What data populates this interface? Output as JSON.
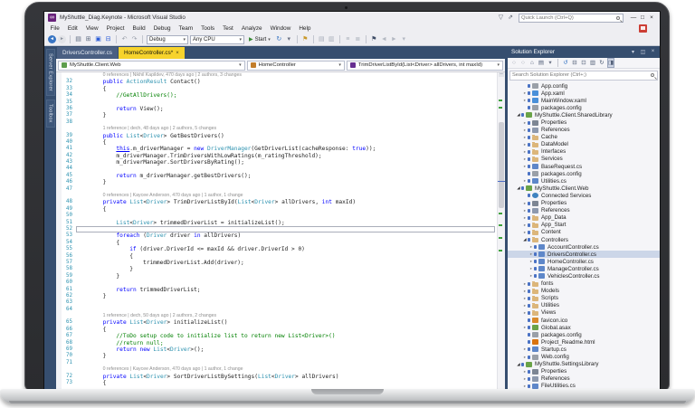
{
  "window": {
    "title": "MyShuttle_Diag.Keynote - Microsoft Visual Studio",
    "quick_launch_placeholder": "Quick Launch (Ctrl+Q)",
    "titlebar_icons": [
      {
        "name": "feedback-icon",
        "glyph": "▽"
      },
      {
        "name": "send-feedback-icon",
        "glyph": "⇗"
      }
    ],
    "buttons": [
      {
        "name": "minimize-button",
        "glyph": "—"
      },
      {
        "name": "maximize-button",
        "glyph": "□"
      },
      {
        "name": "close-button",
        "glyph": "×"
      }
    ]
  },
  "menus": [
    "File",
    "Edit",
    "View",
    "Project",
    "Build",
    "Debug",
    "Team",
    "Tools",
    "Test",
    "Analyze",
    "Window",
    "Help"
  ],
  "toolbar": {
    "config_dropdown": "Debug",
    "platform_dropdown": "Any CPU",
    "start_label": "Start",
    "icons_left": [
      {
        "name": "nav-back-icon",
        "glyph": "◄",
        "fg": "#ffffff",
        "bg": "#3a76c4"
      },
      {
        "name": "nav-forward-icon",
        "glyph": "►",
        "fg": "#8d94a0",
        "bg": "#e3e4e8"
      },
      {
        "name": "sep"
      },
      {
        "name": "new-project-icon",
        "glyph": "▤",
        "fg": "#5d6a80"
      },
      {
        "name": "add-item-icon",
        "glyph": "⊞",
        "fg": "#5d6a80"
      },
      {
        "name": "save-icon",
        "glyph": "▣",
        "fg": "#2a5bd7"
      },
      {
        "name": "save-all-icon",
        "glyph": "⊟",
        "fg": "#2a5bd7"
      },
      {
        "name": "sep"
      },
      {
        "name": "undo-icon",
        "glyph": "↶",
        "fg": "#9aa0ab"
      },
      {
        "name": "redo-icon",
        "glyph": "↷",
        "fg": "#9aa0ab"
      },
      {
        "name": "sep"
      }
    ],
    "icons_right": [
      {
        "name": "refresh-icon",
        "glyph": "↻",
        "fg": "#3a76c4"
      },
      {
        "name": "refresh-caret-icon",
        "glyph": "▾",
        "fg": "#6a7184"
      },
      {
        "name": "sep"
      },
      {
        "name": "intellitrace-icon",
        "glyph": "⚑",
        "fg": "#c9992a"
      },
      {
        "name": "sep"
      },
      {
        "name": "find-in-files-icon",
        "glyph": "▤",
        "fg": "#a7adb8"
      },
      {
        "name": "document-outline-icon",
        "glyph": "▥",
        "fg": "#a7adb8"
      },
      {
        "name": "sep"
      },
      {
        "name": "comment-icon",
        "glyph": "≡",
        "fg": "#a7adb8"
      },
      {
        "name": "uncomment-icon",
        "glyph": "≣",
        "fg": "#a7adb8"
      },
      {
        "name": "sep"
      },
      {
        "name": "bookmark-icon",
        "glyph": "⚑",
        "fg": "#3e4c66"
      },
      {
        "name": "bookmark-prev-icon",
        "glyph": "◄",
        "fg": "#b3b8c2"
      },
      {
        "name": "bookmark-next-icon",
        "glyph": "►",
        "fg": "#b3b8c2"
      },
      {
        "name": "bookmark-menu-icon",
        "glyph": "▾",
        "fg": "#b3b8c2"
      }
    ]
  },
  "left_tabs": [
    "Server Explorer",
    "Toolbox"
  ],
  "editor_tabs": [
    {
      "label": "DriversController.cs",
      "active": false,
      "dirty": ""
    },
    {
      "label": "HomeController.cs",
      "active": true,
      "dirty": "*"
    }
  ],
  "navbar": {
    "project": "MyShuttle.Client.Web",
    "type": "HomeController",
    "member": "TrimDriverListById(List<Driver> allDrivers, int maxId)"
  },
  "code": {
    "lines": [
      {
        "lens": "0 references | Nikhil Kapildev, 470 days ago | 2 authors, 3 changes",
        "sp": 8
      },
      {
        "n": 32,
        "sp": 8,
        "tok": [
          [
            "k",
            "public "
          ],
          [
            "t",
            "ActionResult"
          ],
          [
            "p",
            " Contact()"
          ]
        ]
      },
      {
        "n": 33,
        "sp": 8,
        "tok": [
          [
            "p",
            "{"
          ]
        ]
      },
      {
        "n": 34,
        "sp": 12,
        "tok": [
          [
            "c",
            "//GetAllDrivers();"
          ]
        ]
      },
      {
        "n": 35,
        "sp": 0,
        "tok": []
      },
      {
        "n": 36,
        "sp": 12,
        "tok": [
          [
            "k",
            "return"
          ],
          [
            "p",
            " View();"
          ]
        ]
      },
      {
        "n": 37,
        "sp": 8,
        "tok": [
          [
            "p",
            "}"
          ]
        ]
      },
      {
        "n": 38,
        "sp": 0,
        "tok": []
      },
      {
        "lens": "1 reference | dech, 48 days ago | 2 authors, 5 changes",
        "sp": 8
      },
      {
        "n": 39,
        "sp": 8,
        "tok": [
          [
            "k",
            "public "
          ],
          [
            "t",
            "List"
          ],
          [
            "p",
            "<"
          ],
          [
            "t",
            "Driver"
          ],
          [
            "p",
            "> GetBestDrivers()"
          ]
        ]
      },
      {
        "n": 40,
        "sp": 8,
        "tok": [
          [
            "p",
            "{"
          ]
        ]
      },
      {
        "n": 41,
        "sp": 12,
        "tok": [
          [
            "ku",
            "this"
          ],
          [
            "p",
            ".m_driverManager = "
          ],
          [
            "k",
            "new "
          ],
          [
            "t",
            "DriverManager"
          ],
          [
            "p",
            "(GetDriverList(cacheResponse: "
          ],
          [
            "k",
            "true"
          ],
          [
            "p",
            "));"
          ]
        ]
      },
      {
        "n": 42,
        "sp": 12,
        "tok": [
          [
            "p",
            "m_driverManager.TrimDriversWithLowRatings(m_ratingThreshold);"
          ]
        ]
      },
      {
        "n": 43,
        "sp": 12,
        "tok": [
          [
            "p",
            "m_driverManager.SortDriversByRating();"
          ]
        ]
      },
      {
        "n": 44,
        "sp": 0,
        "tok": []
      },
      {
        "n": 45,
        "sp": 12,
        "tok": [
          [
            "k",
            "return"
          ],
          [
            "p",
            " m_driverManager.getBestDrivers();"
          ]
        ]
      },
      {
        "n": 46,
        "sp": 8,
        "tok": [
          [
            "p",
            "}"
          ]
        ]
      },
      {
        "n": 47,
        "sp": 0,
        "tok": []
      },
      {
        "lens": "0 references | Kaycee Anderson, 470 days ago | 1 author, 1 change",
        "sp": 8
      },
      {
        "n": 48,
        "sp": 8,
        "tok": [
          [
            "k",
            "private "
          ],
          [
            "t",
            "List"
          ],
          [
            "p",
            "<"
          ],
          [
            "t",
            "Driver"
          ],
          [
            "p",
            "> TrimDriverListById("
          ],
          [
            "t",
            "List"
          ],
          [
            "p",
            "<"
          ],
          [
            "t",
            "Driver"
          ],
          [
            "p",
            "> allDrivers, "
          ],
          [
            "k",
            "int"
          ],
          [
            "p",
            " maxId)"
          ]
        ]
      },
      {
        "n": 49,
        "sp": 8,
        "tok": [
          [
            "p",
            "{"
          ]
        ]
      },
      {
        "n": 50,
        "sp": 0,
        "tok": []
      },
      {
        "n": 51,
        "sp": 12,
        "tok": [
          [
            "t",
            "List"
          ],
          [
            "p",
            "<"
          ],
          [
            "t",
            "Driver"
          ],
          [
            "p",
            "> trimmedDriverList = initializeList();"
          ]
        ]
      },
      {
        "n": 52,
        "sp": 12,
        "tok": [],
        "caret": true
      },
      {
        "n": 53,
        "sp": 12,
        "tok": [
          [
            "k",
            "foreach"
          ],
          [
            "p",
            " ("
          ],
          [
            "t",
            "Driver"
          ],
          [
            "p",
            " driver "
          ],
          [
            "k",
            "in"
          ],
          [
            "p",
            " allDrivers)"
          ]
        ]
      },
      {
        "n": 54,
        "sp": 12,
        "tok": [
          [
            "p",
            "{"
          ]
        ]
      },
      {
        "n": 55,
        "sp": 16,
        "tok": [
          [
            "k",
            "if"
          ],
          [
            "p",
            " (driver.DriverId <= maxId && driver.DriverId > 0)"
          ]
        ]
      },
      {
        "n": 56,
        "sp": 16,
        "tok": [
          [
            "p",
            "{"
          ]
        ]
      },
      {
        "n": 57,
        "sp": 20,
        "tok": [
          [
            "p",
            "trimmedDriverList.Add(driver);"
          ]
        ]
      },
      {
        "n": 58,
        "sp": 16,
        "tok": [
          [
            "p",
            "}"
          ]
        ]
      },
      {
        "n": 59,
        "sp": 12,
        "tok": [
          [
            "p",
            "}"
          ]
        ]
      },
      {
        "n": 60,
        "sp": 0,
        "tok": []
      },
      {
        "n": 61,
        "sp": 12,
        "tok": [
          [
            "k",
            "return"
          ],
          [
            "p",
            " trimmedDriverList;"
          ]
        ]
      },
      {
        "n": 62,
        "sp": 8,
        "tok": [
          [
            "p",
            "}"
          ]
        ]
      },
      {
        "n": 63,
        "sp": 0,
        "tok": []
      },
      {
        "n": 64,
        "sp": 0,
        "tok": []
      },
      {
        "lens": "1 reference | dech, 50 days ago | 2 authors, 2 changes",
        "sp": 8
      },
      {
        "n": 65,
        "sp": 8,
        "tok": [
          [
            "k",
            "private "
          ],
          [
            "t",
            "List"
          ],
          [
            "p",
            "<"
          ],
          [
            "t",
            "Driver"
          ],
          [
            "p",
            "> initializeList()"
          ]
        ]
      },
      {
        "n": 66,
        "sp": 8,
        "tok": [
          [
            "p",
            "{"
          ]
        ]
      },
      {
        "n": 67,
        "sp": 12,
        "tok": [
          [
            "c",
            "//ToDo setup code to initialize list to return new List<Driver>()"
          ]
        ]
      },
      {
        "n": 68,
        "sp": 12,
        "tok": [
          [
            "c",
            "//return null;"
          ]
        ]
      },
      {
        "n": 69,
        "sp": 12,
        "tok": [
          [
            "k",
            "return new "
          ],
          [
            "t",
            "List"
          ],
          [
            "p",
            "<"
          ],
          [
            "t",
            "Driver"
          ],
          [
            "p",
            ">();"
          ]
        ]
      },
      {
        "n": 70,
        "sp": 8,
        "tok": [
          [
            "p",
            "}"
          ]
        ]
      },
      {
        "n": 71,
        "sp": 0,
        "tok": []
      },
      {
        "lens": "0 references | Kaycee Anderson, 470 days ago | 1 author, 1 change",
        "sp": 8
      },
      {
        "n": 72,
        "sp": 8,
        "tok": [
          [
            "k",
            "private "
          ],
          [
            "t",
            "List"
          ],
          [
            "p",
            "<"
          ],
          [
            "t",
            "Driver"
          ],
          [
            "p",
            "> SortDriverListBySettings("
          ],
          [
            "t",
            "List"
          ],
          [
            "p",
            "<"
          ],
          [
            "t",
            "Driver"
          ],
          [
            "p",
            "> allDrivers)"
          ]
        ]
      },
      {
        "n": 73,
        "sp": 8,
        "tok": [
          [
            "p",
            "{"
          ]
        ]
      }
    ]
  },
  "solution_explorer": {
    "title": "Solution Explorer",
    "search_placeholder": "Search Solution Explorer (Ctrl+;)",
    "header_icons": [
      {
        "name": "se-window-position-icon",
        "glyph": "▾"
      },
      {
        "name": "se-pin-icon",
        "glyph": "◫"
      },
      {
        "name": "se-close-icon",
        "glyph": "×"
      }
    ],
    "toolbar_icons": [
      {
        "name": "se-back-icon",
        "glyph": "○",
        "fg": "#8d94a0"
      },
      {
        "name": "se-forward-icon",
        "glyph": "○",
        "fg": "#8d94a0"
      },
      {
        "name": "se-home-icon",
        "glyph": "⌂",
        "fg": "#4f5d75"
      },
      {
        "name": "se-switch-views-icon",
        "glyph": "▤",
        "fg": "#4f5d75"
      },
      {
        "name": "se-views-caret-icon",
        "glyph": "▾",
        "fg": "#6a7184"
      },
      {
        "name": "sep"
      },
      {
        "name": "se-sync-with-active-icon",
        "glyph": "↺",
        "fg": "#3a76c4"
      },
      {
        "name": "se-collapse-all-icon",
        "glyph": "⊟",
        "fg": "#4f5d75"
      },
      {
        "name": "se-properties-icon",
        "glyph": "⊡",
        "fg": "#4f5d75"
      },
      {
        "name": "se-show-all-files-icon",
        "glyph": "▥",
        "fg": "#4f5d75"
      },
      {
        "name": "se-refresh-icon",
        "glyph": "↻",
        "fg": "#4f5d75"
      },
      {
        "name": "se-preview-selected-icon",
        "glyph": "◨",
        "fg": "#4f5d75",
        "pressed": true
      }
    ],
    "items": [
      {
        "label": "App.config",
        "indent": 2,
        "arrow": "",
        "icon": "config"
      },
      {
        "label": "App.xaml",
        "indent": 2,
        "arrow": "c",
        "icon": "xaml"
      },
      {
        "label": "MainWindow.xaml",
        "indent": 2,
        "arrow": "c",
        "icon": "xaml"
      },
      {
        "label": "packages.config",
        "indent": 2,
        "arrow": "",
        "icon": "config"
      },
      {
        "label": "MyShuttle.Client.SharedLibrary",
        "indent": 1,
        "arrow": "e",
        "icon": "proj"
      },
      {
        "label": "Properties",
        "indent": 2,
        "arrow": "c",
        "icon": "props"
      },
      {
        "label": "References",
        "indent": 2,
        "arrow": "c",
        "icon": "refs"
      },
      {
        "label": "Cache",
        "indent": 2,
        "arrow": "c",
        "icon": "folder"
      },
      {
        "label": "DataModel",
        "indent": 2,
        "arrow": "c",
        "icon": "folder"
      },
      {
        "label": "Interfaces",
        "indent": 2,
        "arrow": "c",
        "icon": "folder"
      },
      {
        "label": "Services",
        "indent": 2,
        "arrow": "c",
        "icon": "folder"
      },
      {
        "label": "BaseRequest.cs",
        "indent": 2,
        "arrow": "c",
        "icon": "cs"
      },
      {
        "label": "packages.config",
        "indent": 2,
        "arrow": "",
        "icon": "config"
      },
      {
        "label": "Utilities.cs",
        "indent": 2,
        "arrow": "c",
        "icon": "cs"
      },
      {
        "label": "MyShuttle.Client.Web",
        "indent": 1,
        "arrow": "e",
        "icon": "proj"
      },
      {
        "label": "Connected Services",
        "indent": 2,
        "arrow": "",
        "icon": "globe"
      },
      {
        "label": "Properties",
        "indent": 2,
        "arrow": "c",
        "icon": "props"
      },
      {
        "label": "References",
        "indent": 2,
        "arrow": "c",
        "icon": "refs"
      },
      {
        "label": "App_Data",
        "indent": 2,
        "arrow": "c",
        "icon": "folder"
      },
      {
        "label": "App_Start",
        "indent": 2,
        "arrow": "c",
        "icon": "folder"
      },
      {
        "label": "Content",
        "indent": 2,
        "arrow": "c",
        "icon": "folder"
      },
      {
        "label": "Controllers",
        "indent": 2,
        "arrow": "e",
        "icon": "folder"
      },
      {
        "label": "AccountController.cs",
        "indent": 3,
        "arrow": "c",
        "icon": "cs"
      },
      {
        "label": "DriversController.cs",
        "indent": 3,
        "arrow": "c",
        "icon": "cs",
        "selected": true
      },
      {
        "label": "HomeController.cs",
        "indent": 3,
        "arrow": "c",
        "icon": "cs"
      },
      {
        "label": "ManageController.cs",
        "indent": 3,
        "arrow": "c",
        "icon": "cs"
      },
      {
        "label": "VehiclesController.cs",
        "indent": 3,
        "arrow": "c",
        "icon": "cs"
      },
      {
        "label": "fonts",
        "indent": 2,
        "arrow": "c",
        "icon": "folder"
      },
      {
        "label": "Models",
        "indent": 2,
        "arrow": "c",
        "icon": "folder"
      },
      {
        "label": "Scripts",
        "indent": 2,
        "arrow": "c",
        "icon": "folder"
      },
      {
        "label": "Utilities",
        "indent": 2,
        "arrow": "c",
        "icon": "folder"
      },
      {
        "label": "Views",
        "indent": 2,
        "arrow": "c",
        "icon": "folder"
      },
      {
        "label": "favicon.ico",
        "indent": 2,
        "arrow": "",
        "icon": "ico"
      },
      {
        "label": "Global.asax",
        "indent": 2,
        "arrow": "c",
        "icon": "asax"
      },
      {
        "label": "packages.config",
        "indent": 2,
        "arrow": "",
        "icon": "config"
      },
      {
        "label": "Project_Readme.html",
        "indent": 2,
        "arrow": "",
        "icon": "html"
      },
      {
        "label": "Startup.cs",
        "indent": 2,
        "arrow": "c",
        "icon": "cs"
      },
      {
        "label": "Web.config",
        "indent": 2,
        "arrow": "c",
        "icon": "config"
      },
      {
        "label": "MyShuttle.SettingsLibrary",
        "indent": 1,
        "arrow": "e",
        "icon": "proj"
      },
      {
        "label": "Properties",
        "indent": 2,
        "arrow": "c",
        "icon": "props"
      },
      {
        "label": "References",
        "indent": 2,
        "arrow": "c",
        "icon": "refs"
      },
      {
        "label": "FileUtilities.cs",
        "indent": 2,
        "arrow": "c",
        "icon": "cs"
      }
    ]
  },
  "colors": {
    "active_tab_yellow": "#f7d32c",
    "dock_blue": "#364e6f",
    "keyword_blue": "#0000ff",
    "type_teal": "#2b91af",
    "comment_green": "#008000",
    "line_number": "#2b91af",
    "codelens_gray": "#8f8f8f",
    "selection_row": "#ccd6e8",
    "vs_logo_purple": "#68217a",
    "start_green": "#388a34",
    "red_badge": "#cc3e35"
  }
}
